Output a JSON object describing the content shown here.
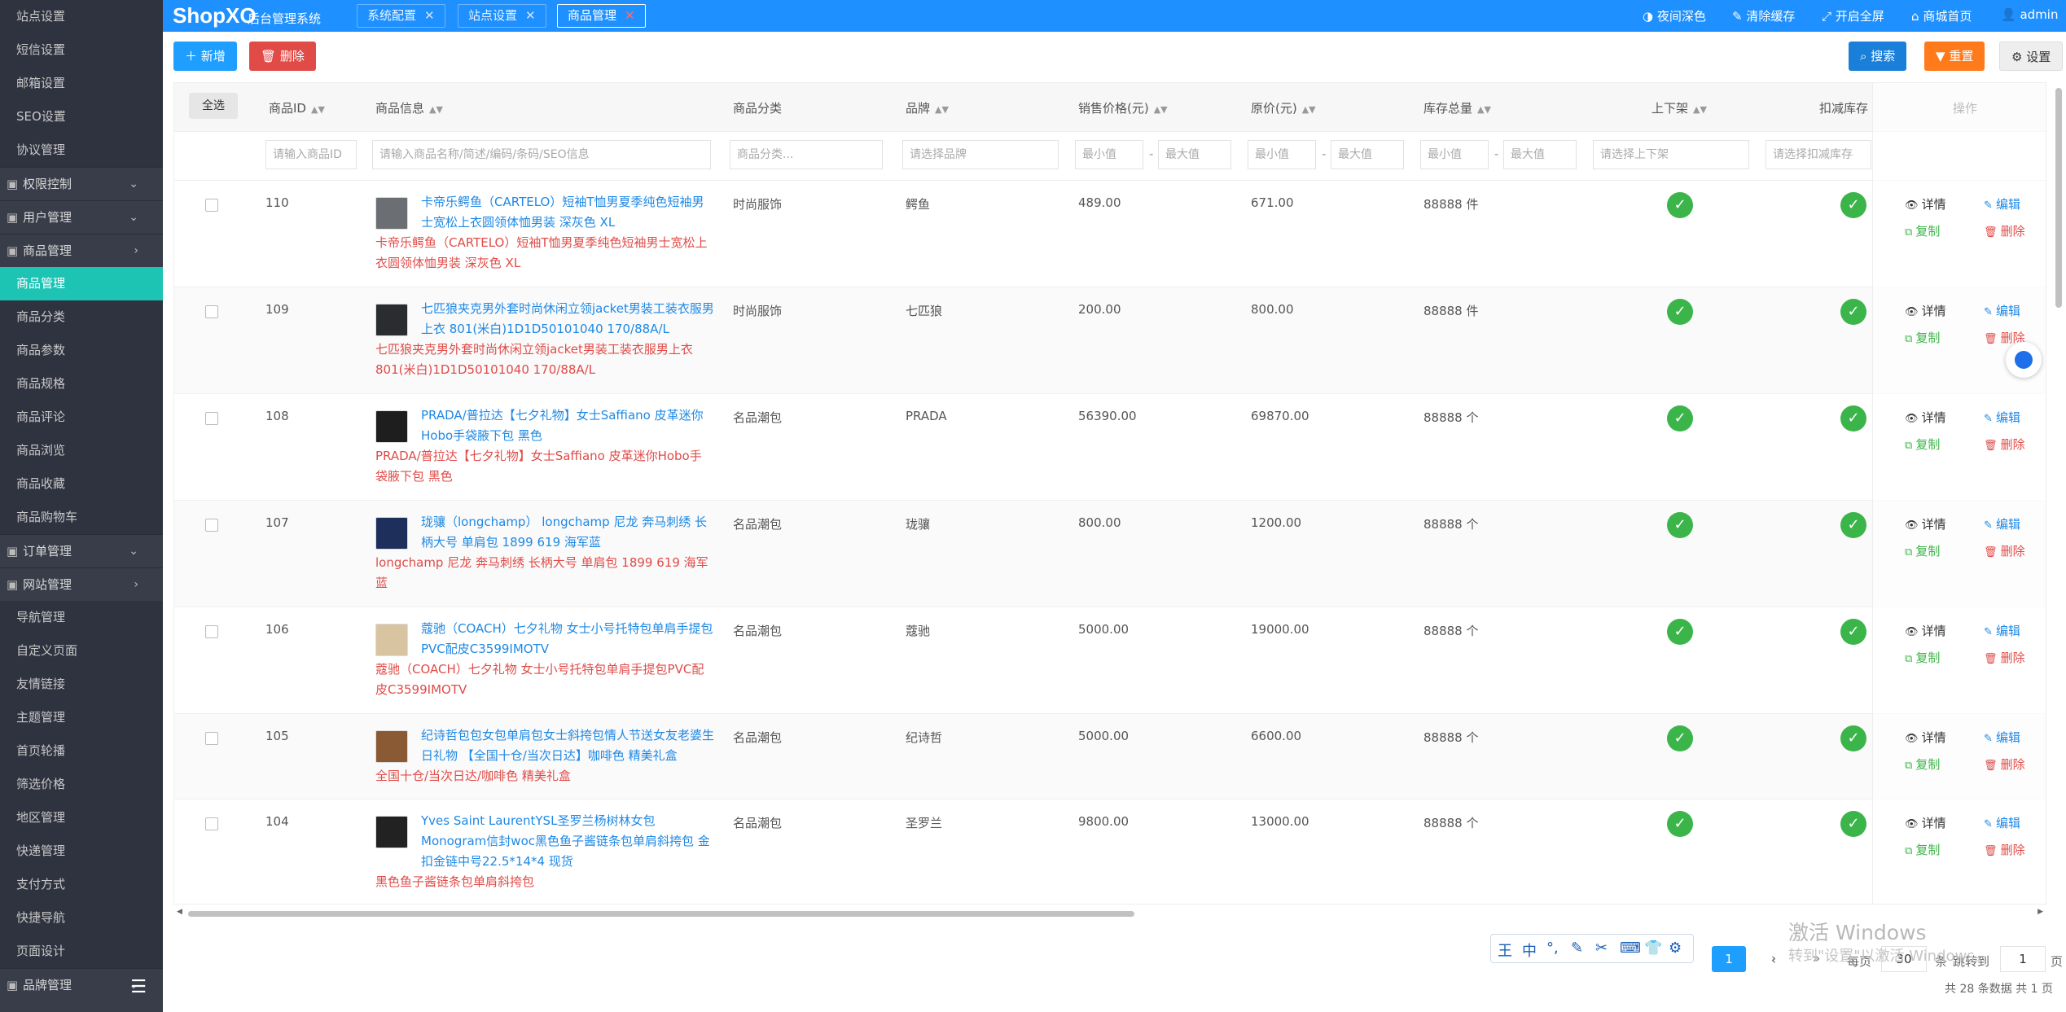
{
  "sidebar": {
    "items": [
      {
        "label": "站点设置",
        "kind": "sub"
      },
      {
        "label": "短信设置",
        "kind": "sub"
      },
      {
        "label": "邮箱设置",
        "kind": "sub"
      },
      {
        "label": "SEO设置",
        "kind": "sub"
      },
      {
        "label": "协议管理",
        "kind": "sub"
      },
      {
        "label": "权限控制",
        "kind": "group",
        "arrow": "⌄"
      },
      {
        "label": "用户管理",
        "kind": "group",
        "arrow": "⌄"
      },
      {
        "label": "商品管理",
        "kind": "group",
        "arrow": "›"
      },
      {
        "label": "商品管理",
        "kind": "active"
      },
      {
        "label": "商品分类",
        "kind": "sub"
      },
      {
        "label": "商品参数",
        "kind": "sub"
      },
      {
        "label": "商品规格",
        "kind": "sub"
      },
      {
        "label": "商品评论",
        "kind": "sub"
      },
      {
        "label": "商品浏览",
        "kind": "sub"
      },
      {
        "label": "商品收藏",
        "kind": "sub"
      },
      {
        "label": "商品购物车",
        "kind": "sub"
      },
      {
        "label": "订单管理",
        "kind": "group",
        "arrow": "⌄"
      },
      {
        "label": "网站管理",
        "kind": "group",
        "arrow": "›"
      },
      {
        "label": "导航管理",
        "kind": "sub"
      },
      {
        "label": "自定义页面",
        "kind": "sub"
      },
      {
        "label": "友情链接",
        "kind": "sub"
      },
      {
        "label": "主题管理",
        "kind": "sub"
      },
      {
        "label": "首页轮播",
        "kind": "sub"
      },
      {
        "label": "筛选价格",
        "kind": "sub"
      },
      {
        "label": "地区管理",
        "kind": "sub"
      },
      {
        "label": "快递管理",
        "kind": "sub"
      },
      {
        "label": "支付方式",
        "kind": "sub"
      },
      {
        "label": "快捷导航",
        "kind": "sub"
      },
      {
        "label": "页面设计",
        "kind": "sub"
      },
      {
        "label": "品牌管理",
        "kind": "group",
        "arrow": "⌄"
      }
    ]
  },
  "header": {
    "logo": "ShopXO",
    "logo_sub": "后台管理系统",
    "tabs": [
      {
        "label": "系统配置",
        "close": "✕"
      },
      {
        "label": "站点设置",
        "close": "✕"
      },
      {
        "label": "商品管理",
        "close": "✕"
      }
    ],
    "right": [
      {
        "icon": "◑",
        "label": "夜间深色"
      },
      {
        "icon": "✎",
        "label": "清除缓存"
      },
      {
        "icon": "⤢",
        "label": "开启全屏"
      },
      {
        "icon": "⌂",
        "label": "商城首页"
      },
      {
        "icon": "👤",
        "label": "admin"
      }
    ]
  },
  "toolbar": {
    "add": "新增",
    "delete": "删除",
    "search": "搜索",
    "reset": "重置",
    "settings": "设置"
  },
  "table": {
    "select_all": "全选",
    "columns": [
      "商品ID",
      "商品信息",
      "商品分类",
      "品牌",
      "销售价格(元)",
      "原价(元)",
      "库存总量",
      "上下架",
      "扣减库存",
      "操作"
    ],
    "filters": {
      "id": "请输入商品ID",
      "info": "请输入商品名称/简述/编码/条码/SEO信息",
      "category": "商品分类...",
      "brand": "请选择品牌",
      "min": "最小值",
      "max": "最大值",
      "shelf": "请选择上下架",
      "deduct": "请选择扣减库存"
    },
    "actions": {
      "detail": "详情",
      "edit": "编辑",
      "copy": "复制",
      "delete": "删除"
    },
    "rows": [
      {
        "id": "110",
        "name": "卡帝乐鳄鱼（CARTELO）短袖T恤男夏季纯色短袖男士宽松上衣圆领体恤男装 深灰色 XL",
        "desc": "卡帝乐鳄鱼（CARTELO）短袖T恤男夏季纯色短袖男士宽松上衣圆领体恤男装 深灰色 XL",
        "category": "时尚服饰",
        "brand": "鳄鱼",
        "price": "489.00",
        "original": "671.00",
        "stock": "88888 件",
        "thumb": "#6b6e72"
      },
      {
        "id": "109",
        "name": "七匹狼夹克男外套时尚休闲立领jacket男装工装衣服男上衣 801(米白)1D1D50101040 170/88A/L",
        "desc": "七匹狼夹克男外套时尚休闲立领jacket男装工装衣服男上衣 801(米白)1D1D50101040 170/88A/L",
        "category": "时尚服饰",
        "brand": "七匹狼",
        "price": "200.00",
        "original": "800.00",
        "stock": "88888 件",
        "thumb": "#2a2c30"
      },
      {
        "id": "108",
        "name": "PRADA/普拉达【七夕礼物】女士Saffiano 皮革迷你Hobo手袋腋下包 黑色",
        "desc": "PRADA/普拉达【七夕礼物】女士Saffiano 皮革迷你Hobo手袋腋下包 黑色",
        "category": "名品潮包",
        "brand": "PRADA",
        "price": "56390.00",
        "original": "69870.00",
        "stock": "88888 个",
        "thumb": "#1e1e1e"
      },
      {
        "id": "107",
        "name": "珑骧（longchamp） longchamp 尼龙 奔马刺绣 长柄大号 单肩包 1899 619 海军蓝",
        "desc": "longchamp 尼龙 奔马刺绣 长柄大号 单肩包 1899 619 海军蓝",
        "category": "名品潮包",
        "brand": "珑骧",
        "price": "800.00",
        "original": "1200.00",
        "stock": "88888 个",
        "thumb": "#1f2f5c"
      },
      {
        "id": "106",
        "name": "蔻驰（COACH）七夕礼物 女士小号托特包单肩手提包PVC配皮C3599IMOTV",
        "desc": "蔻驰（COACH）七夕礼物 女士小号托特包单肩手提包PVC配皮C3599IMOTV",
        "category": "名品潮包",
        "brand": "蔻驰",
        "price": "5000.00",
        "original": "19000.00",
        "stock": "88888 个",
        "thumb": "#d8c4a0"
      },
      {
        "id": "105",
        "name": "纪诗哲包包女包单肩包女士斜挎包情人节送女友老婆生日礼物 【全国十仓/当次日达】咖啡色 精美礼盒",
        "desc": "全国十仓/当次日达/咖啡色 精美礼盒",
        "category": "名品潮包",
        "brand": "纪诗哲",
        "price": "5000.00",
        "original": "6600.00",
        "stock": "88888 个",
        "thumb": "#8a5a34"
      },
      {
        "id": "104",
        "name": "Yves Saint LaurentYSL圣罗兰杨树林女包Monogram信封woc黑色鱼子酱链条包单肩斜挎包 金扣金链中号22.5*14*4 现货",
        "desc": "黑色鱼子酱链条包单肩斜挎包",
        "category": "名品潮包",
        "brand": "圣罗兰",
        "price": "9800.00",
        "original": "13000.00",
        "stock": "88888 个",
        "thumb": "#222222"
      }
    ]
  },
  "pagination": {
    "prev": "‹",
    "current": "1",
    "next": "›",
    "last": "»",
    "per_page_label": "每页",
    "per_page": "30",
    "per_page_unit": "条",
    "jump_label": "跳转到",
    "jump_value": "1",
    "jump_unit": "页",
    "summary": "共 28 条数据   共 1 页"
  },
  "ime": {
    "keys": [
      "王",
      "中",
      "°,",
      "✎",
      "✂",
      "⌨",
      "👕",
      "⚙"
    ]
  },
  "watermark": {
    "title": "激活 Windows",
    "subtitle": "转到\"设置\"以激活 Windows。"
  },
  "colors": {
    "header": "#1e90ff",
    "sidebar": "#393d49",
    "active": "#1dc4b4",
    "link": "#1e88e5",
    "danger": "#e04b48",
    "success": "#3bb54a"
  }
}
